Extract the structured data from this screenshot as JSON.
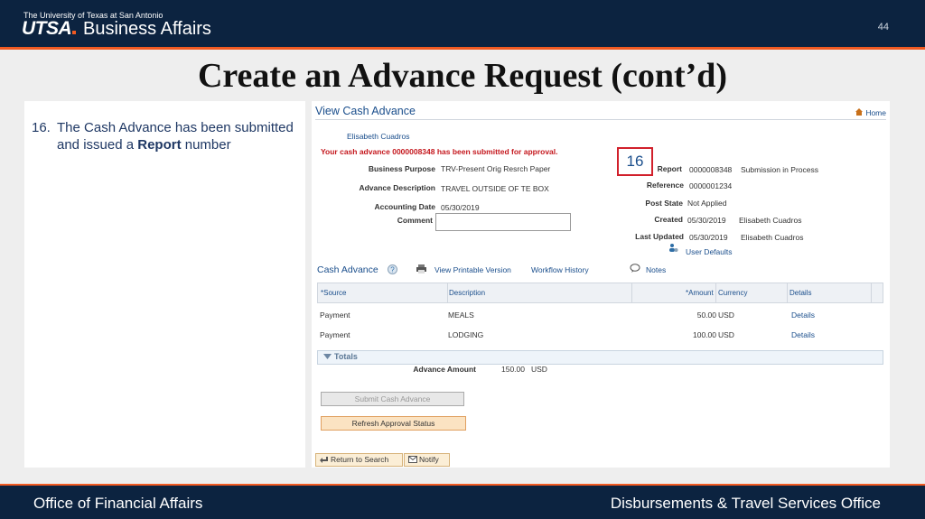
{
  "header": {
    "university": "The University of Texas at San Antonio",
    "logo_utsa": "UTSA",
    "logo_dept": "Business Affairs",
    "page_number": "44"
  },
  "slide_title": "Create an Advance Request (cont’d)",
  "step": {
    "number": "16.",
    "text_before": "The Cash Advance has been submitted and issued a ",
    "text_bold": "Report",
    "text_after": " number"
  },
  "screen": {
    "title": "View Cash Advance",
    "home_link": "Home",
    "employee_name": "Elisabeth Cuadros",
    "message": "Your cash advance 0000008348 has been submitted for approval.",
    "callout": "16",
    "fields_left": [
      {
        "label": "Business Purpose",
        "value": "TRV-Present Orig Resrch Paper"
      },
      {
        "label": "Advance Description",
        "value": "TRAVEL OUTSIDE OF TE BOX"
      },
      {
        "label": "Accounting Date",
        "value": "05/30/2019"
      },
      {
        "label": "Comment",
        "value": ""
      }
    ],
    "fields_right": {
      "report_label": "Report",
      "report_value": "0000008348",
      "report_status": "Submission in Process",
      "reference_label": "Reference",
      "reference_value": "0000001234",
      "post_state_label": "Post State",
      "post_state_value": "Not Applied",
      "created_label": "Created",
      "created_date": "05/30/2019",
      "created_by": "Elisabeth Cuadros",
      "updated_label": "Last Updated",
      "updated_date": "05/30/2019",
      "updated_by": "Elisabeth Cuadros",
      "user_defaults": "User Defaults"
    },
    "section": {
      "title": "Cash Advance",
      "printable": "View Printable Version",
      "workflow": "Workflow History",
      "notes": "Notes"
    },
    "table": {
      "headers": [
        "*Source",
        "Description",
        "*Amount",
        "Currency",
        "Details"
      ],
      "rows": [
        {
          "source": "Payment",
          "description": "MEALS",
          "amount": "50.00",
          "currency": "USD",
          "details": "Details"
        },
        {
          "source": "Payment",
          "description": "LODGING",
          "amount": "100.00",
          "currency": "USD",
          "details": "Details"
        }
      ]
    },
    "totals": {
      "title": "Totals",
      "label": "Advance Amount",
      "amount": "150.00",
      "currency": "USD"
    },
    "buttons": {
      "submit": "Submit Cash Advance",
      "refresh": "Refresh Approval Status",
      "return": "Return to Search",
      "notify": "Notify"
    }
  },
  "footer": {
    "left": "Office of Financial Affairs",
    "right": "Disbursements & Travel Services Office"
  },
  "colors": {
    "navy": "#0c2340",
    "orange": "#f15a22",
    "link_blue": "#1a4e8c",
    "message_red": "#c4161c"
  }
}
